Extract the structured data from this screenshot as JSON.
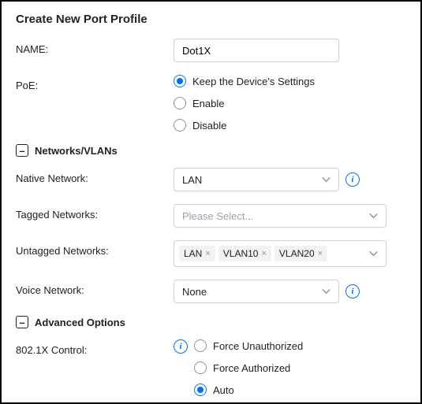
{
  "title": "Create New Port Profile",
  "name_label": "NAME:",
  "name_value": "Dot1X",
  "poe_label": "PoE:",
  "poe_options": {
    "keep": "Keep the Device's Settings",
    "enable": "Enable",
    "disable": "Disable"
  },
  "sections": {
    "networks": "Networks/VLANs",
    "advanced": "Advanced Options"
  },
  "native_network_label": "Native Network:",
  "native_network_value": "LAN",
  "tagged_networks_label": "Tagged Networks:",
  "tagged_placeholder": "Please Select...",
  "untagged_networks_label": "Untagged Networks:",
  "untagged_tags": {
    "t0": "LAN",
    "t1": "VLAN10",
    "t2": "VLAN20"
  },
  "voice_network_label": "Voice Network:",
  "voice_network_value": "None",
  "dot1x_label": "802.1X Control:",
  "dot1x_options": {
    "force_unauth": "Force Unauthorized",
    "force_auth": "Force Authorized",
    "auto": "Auto"
  },
  "collapse_glyph": "–"
}
